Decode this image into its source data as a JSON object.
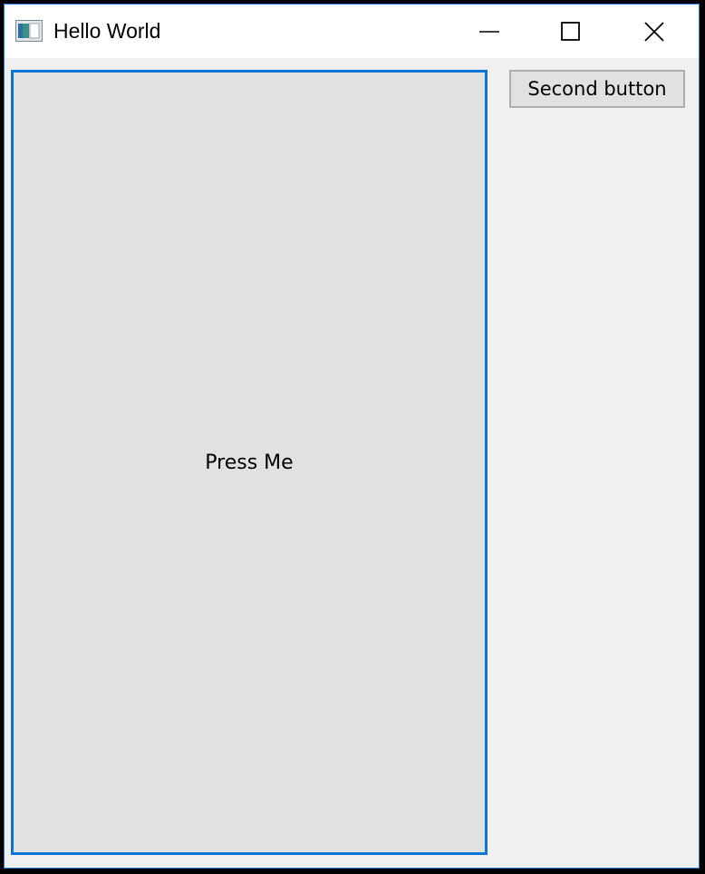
{
  "window": {
    "title": "Hello World",
    "accent_color": "#0a74d9",
    "icon": "app-window-icon",
    "controls": {
      "minimize_icon": "minimize-icon",
      "maximize_icon": "maximize-icon",
      "close_icon": "close-icon"
    }
  },
  "main": {
    "press_button_label": "Press Me",
    "second_button_label": "Second button"
  }
}
